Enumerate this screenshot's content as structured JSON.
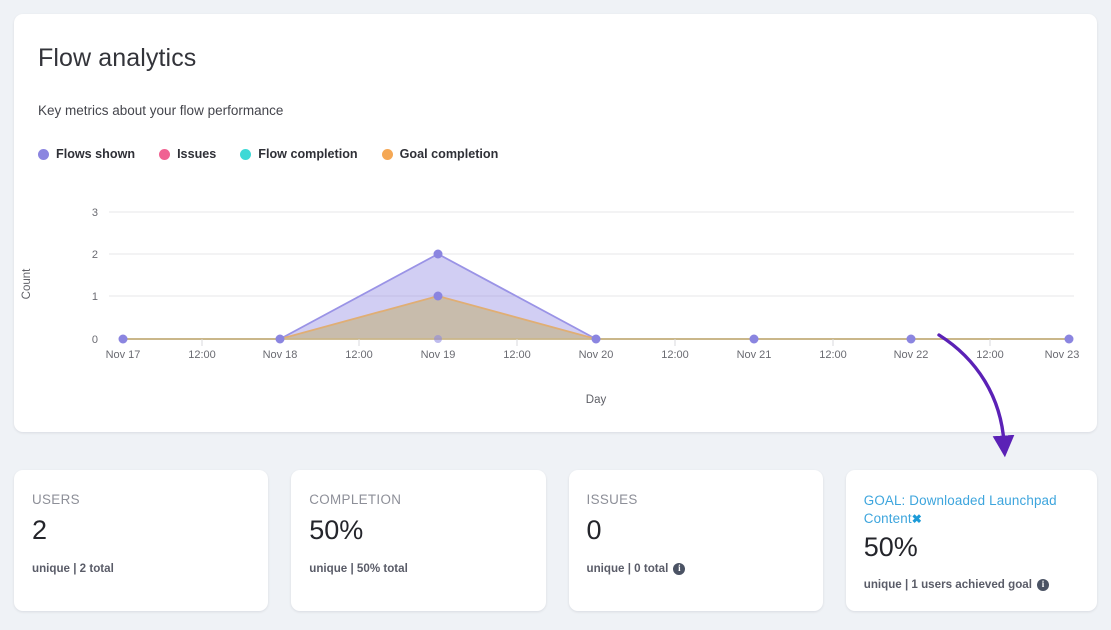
{
  "header": {
    "title": "Flow analytics",
    "subtitle": "Key metrics about your flow performance"
  },
  "legend": [
    {
      "label": "Flows shown",
      "color": "#8b85e0"
    },
    {
      "label": "Issues",
      "color": "#f06292"
    },
    {
      "label": "Flow completion",
      "color": "#3dd9d6"
    },
    {
      "label": "Goal completion",
      "color": "#f5a855"
    }
  ],
  "chart_data": {
    "type": "area",
    "title": "Flow analytics",
    "xlabel": "Day",
    "ylabel": "Count",
    "ylim": [
      0,
      3
    ],
    "yticks": [
      0,
      1,
      2,
      3
    ],
    "grid": true,
    "legend_position": "top-left",
    "categories": [
      "Nov 17",
      "12:00",
      "Nov 18",
      "12:00",
      "Nov 19",
      "12:00",
      "Nov 20",
      "12:00",
      "Nov 21",
      "12:00",
      "Nov 22",
      "12:00",
      "Nov 23"
    ],
    "major_ticks": [
      "Nov 17",
      "Nov 18",
      "Nov 19",
      "Nov 20",
      "Nov 21",
      "Nov 22",
      "Nov 23"
    ],
    "series": [
      {
        "name": "Flows shown",
        "color": "#8b85e0",
        "values": [
          0,
          0,
          2,
          0,
          0,
          0,
          0
        ]
      },
      {
        "name": "Issues",
        "color": "#f06292",
        "values": [
          0,
          0,
          0,
          0,
          0,
          0,
          0
        ]
      },
      {
        "name": "Flow completion",
        "color": "#3dd9d6",
        "values": [
          0,
          0,
          0,
          0,
          0,
          0,
          0
        ]
      },
      {
        "name": "Goal completion",
        "color": "#f5a855",
        "values": [
          0,
          0,
          1,
          0,
          0,
          0,
          0
        ]
      }
    ]
  },
  "metrics": {
    "users": {
      "label": "USERS",
      "value": "2",
      "footer": "unique | 2 total",
      "info": false
    },
    "completion": {
      "label": "COMPLETION",
      "value": "50%",
      "footer": "unique | 50% total",
      "info": false
    },
    "issues": {
      "label": "ISSUES",
      "value": "0",
      "footer": "unique | 0 total",
      "info": true
    },
    "goal": {
      "label": "GOAL: Downloaded Launchpad Content",
      "remove_icon": "✖",
      "value": "50%",
      "footer": "unique | 1 users achieved goal",
      "info": true
    }
  },
  "annotation": {
    "arrow_color": "#5b21b6"
  },
  "info_glyph": "i"
}
